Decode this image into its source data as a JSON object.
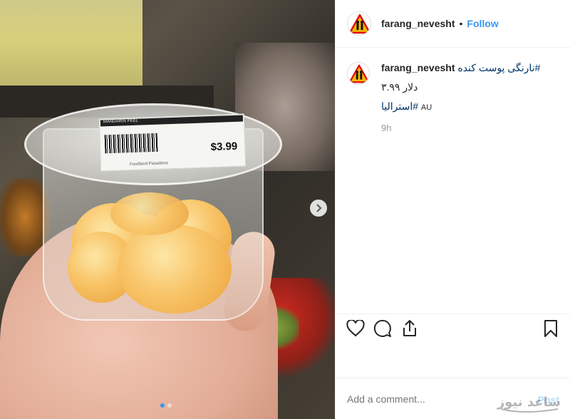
{
  "post": {
    "username": "farang_nevesht",
    "separator": "•",
    "follow_label": "Follow",
    "caption": {
      "username": "farang_nevesht",
      "text": "نارنگی پوست کنده#",
      "price_line": "دلار ۳.۹۹",
      "tag_line": "استرالیا#",
      "tag_suffix": "AU",
      "time": "9h"
    },
    "comment_placeholder": "Add a comment...",
    "post_label": "Post",
    "watermark_text": "ساعد نیوز"
  },
  "photo": {
    "label_header": "MANDARIN PEEL",
    "price": "$3.99",
    "label_small": "Foodland Pasadena"
  },
  "carousel": {
    "dots": 2,
    "active_index": 0
  },
  "icons": {
    "next": "chevron-right-icon",
    "like": "heart-icon",
    "comment": "comment-icon",
    "share": "share-icon",
    "save": "bookmark-icon"
  },
  "colors": {
    "accent": "#3897f0",
    "text": "#262626",
    "muted": "#999999",
    "border": "#efefef"
  }
}
